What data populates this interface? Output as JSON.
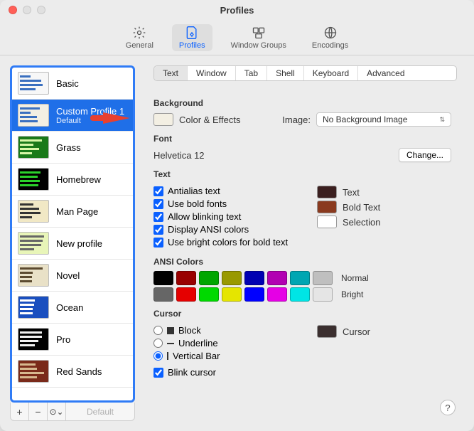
{
  "window": {
    "title": "Profiles"
  },
  "toolbar": {
    "items": [
      {
        "label": "General"
      },
      {
        "label": "Profiles"
      },
      {
        "label": "Window Groups"
      },
      {
        "label": "Encodings"
      }
    ]
  },
  "sidebar": {
    "profiles": [
      {
        "name": "Basic",
        "bg": "#f7f7f7",
        "fg": "#3a6fbf"
      },
      {
        "name": "Custom Profile 1",
        "sub": "Default",
        "selected": true,
        "bg": "#f3efe3",
        "fg": "#3a6fbf"
      },
      {
        "name": "Grass",
        "bg": "#1a7a1a",
        "fg": "#d7f7a7"
      },
      {
        "name": "Homebrew",
        "bg": "#000000",
        "fg": "#2bd12b"
      },
      {
        "name": "Man Page",
        "bg": "#f1e8c5",
        "fg": "#333333"
      },
      {
        "name": "New profile",
        "bg": "#e8f5b8",
        "fg": "#666666"
      },
      {
        "name": "Novel",
        "bg": "#e9e1c7",
        "fg": "#5b4a2f"
      },
      {
        "name": "Ocean",
        "bg": "#1a4fbf",
        "fg": "#ffffff"
      },
      {
        "name": "Pro",
        "bg": "#000000",
        "fg": "#f2f2f2"
      },
      {
        "name": "Red Sands",
        "bg": "#7a2a1a",
        "fg": "#d7b78f"
      }
    ],
    "footer": {
      "add": "+",
      "remove": "−",
      "menu": "⊙",
      "default_btn": "Default"
    }
  },
  "tabs": [
    "Text",
    "Window",
    "Tab",
    "Shell",
    "Keyboard",
    "Advanced"
  ],
  "sections": {
    "background": {
      "title": "Background",
      "color_effects": "Color & Effects",
      "image_label": "Image:",
      "image_select": "No Background Image"
    },
    "font": {
      "title": "Font",
      "value": "Helvetica 12",
      "change": "Change..."
    },
    "text": {
      "title": "Text",
      "opts": [
        "Antialias text",
        "Use bold fonts",
        "Allow blinking text",
        "Display ANSI colors",
        "Use bright colors for bold text"
      ],
      "swatches": [
        {
          "label": "Text",
          "color": "#3b1f1f"
        },
        {
          "label": "Bold Text",
          "color": "#8a3a1f"
        },
        {
          "label": "Selection",
          "color": "#ffffff"
        }
      ]
    },
    "ansi": {
      "title": "ANSI Colors",
      "normal_label": "Normal",
      "bright_label": "Bright",
      "normal": [
        "#000000",
        "#990000",
        "#00a600",
        "#999900",
        "#0000b2",
        "#b200b2",
        "#00a6b2",
        "#bfbfbf"
      ],
      "bright": [
        "#666666",
        "#e50000",
        "#00d900",
        "#e5e500",
        "#0000ff",
        "#e500e5",
        "#00e5e5",
        "#e5e5e5"
      ]
    },
    "cursor": {
      "title": "Cursor",
      "opts": [
        "Block",
        "Underline",
        "Vertical Bar"
      ],
      "blink": "Blink cursor",
      "swatch_label": "Cursor",
      "swatch_color": "#3b2f2f"
    }
  },
  "help": "?"
}
